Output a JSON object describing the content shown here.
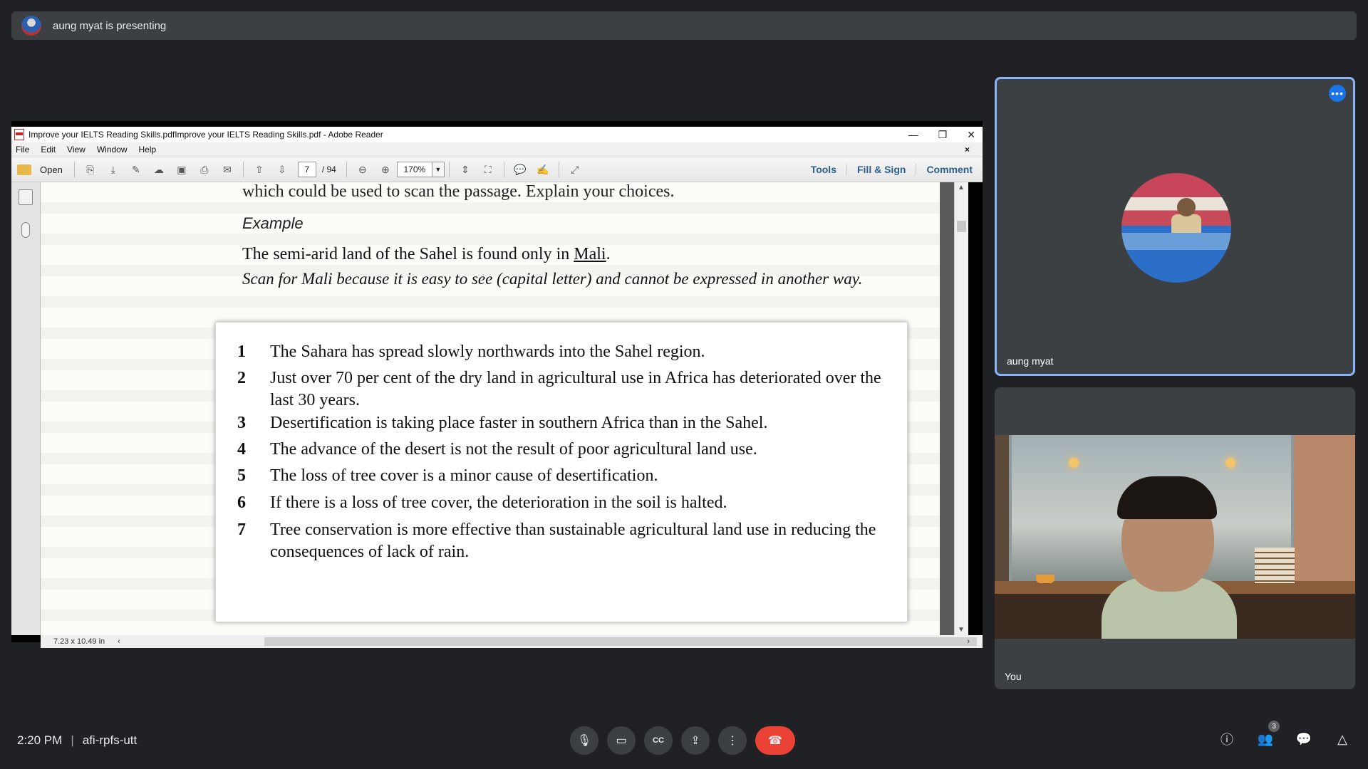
{
  "banner": {
    "text": "aung myat is presenting"
  },
  "reader": {
    "title": "Improve your IELTS Reading Skills.pdfImprove your IELTS Reading Skills.pdf - Adobe Reader",
    "menu": [
      "File",
      "Edit",
      "View",
      "Window",
      "Help"
    ],
    "toolbar": {
      "open_label": "Open",
      "page_current": "7",
      "page_total": "/ 94",
      "zoom": "170%",
      "tools_label": "Tools",
      "fill_sign_label": "Fill & Sign",
      "comment_label": "Comment"
    },
    "status_size": "7.23 x 10.49 in",
    "doc": {
      "top_line": "which could be used to scan the passage. Explain your choices.",
      "example_heading": "Example",
      "statement_prefix": "The semi-arid land of the Sahel is found only in ",
      "statement_underlined": "Mali",
      "statement_suffix": ".",
      "scan_note": "Scan for Mali because it is easy to see (capital letter) and cannot be expressed in another way.",
      "items": [
        {
          "num": "1",
          "text": "The Sahara has spread slowly northwards into the Sahel region."
        },
        {
          "num": "2",
          "text": "Just over 70 per cent of the dry land in agricultural use in Africa has deteriorated over the last 30 years."
        },
        {
          "num": "3",
          "text": "Desertification is taking place faster in southern Africa than in the Sahel."
        },
        {
          "num": "4",
          "text": "The advance of the desert is not the result of poor agricultural land use."
        },
        {
          "num": "5",
          "text": "The loss of tree cover is a minor cause of desertification."
        },
        {
          "num": "6",
          "text": "If there is a loss of tree cover, the deterioration in the soil is halted."
        },
        {
          "num": "7",
          "text": "Tree conservation is more effective than sustainable agricultural land use in reducing the consequences of lack of rain."
        }
      ]
    }
  },
  "participants": {
    "presenter_name": "aung myat",
    "self_name": "You"
  },
  "meeting": {
    "time": "2:20 PM",
    "separator": "|",
    "code": "afi-rpfs-utt",
    "people_count": "3"
  },
  "colors": {
    "background": "#202124",
    "tile": "#3c4043",
    "active_border": "#8ab4f8",
    "end_call": "#ea4335",
    "accent": "#1a73e8"
  }
}
